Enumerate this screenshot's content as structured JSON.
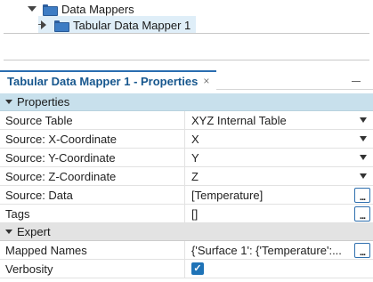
{
  "tree": {
    "items": [
      {
        "label": "Data Mappers",
        "icon": "folder-icon",
        "expanded": true
      },
      {
        "label": "Tabular Data Mapper 1",
        "icon": "folder-icon",
        "expanded": false,
        "selected": true
      }
    ]
  },
  "panel": {
    "title": "Tabular Data Mapper 1 - Properties",
    "close_glyph": "×",
    "minimize_icon": "minimize-icon"
  },
  "sections": {
    "properties": {
      "label": "Properties"
    },
    "expert": {
      "label": "Expert"
    }
  },
  "properties": [
    {
      "name": "Source Table",
      "value": "XYZ Internal Table",
      "control": "dropdown"
    },
    {
      "name": "Source: X-Coordinate",
      "value": "X",
      "control": "dropdown"
    },
    {
      "name": "Source: Y-Coordinate",
      "value": "Y",
      "control": "dropdown"
    },
    {
      "name": "Source: Z-Coordinate",
      "value": "Z",
      "control": "dropdown"
    },
    {
      "name": "Source: Data",
      "value": "[Temperature]",
      "control": "ellipsis"
    },
    {
      "name": "Tags",
      "value": "[]",
      "control": "ellipsis"
    }
  ],
  "expert": [
    {
      "name": "Mapped Names",
      "value": "{'Surface 1': {'Temperature':...",
      "control": "ellipsis"
    },
    {
      "name": "Verbosity",
      "value": "✓",
      "checked": true,
      "control": "checkbox"
    }
  ],
  "ellipsis_label": "...",
  "colors": {
    "accent": "#17578e",
    "section_bg": "#c8e0ec",
    "expert_bg": "#e3e3e3",
    "selection_bg": "#dfeef8",
    "checkbox": "#1f73b7"
  }
}
